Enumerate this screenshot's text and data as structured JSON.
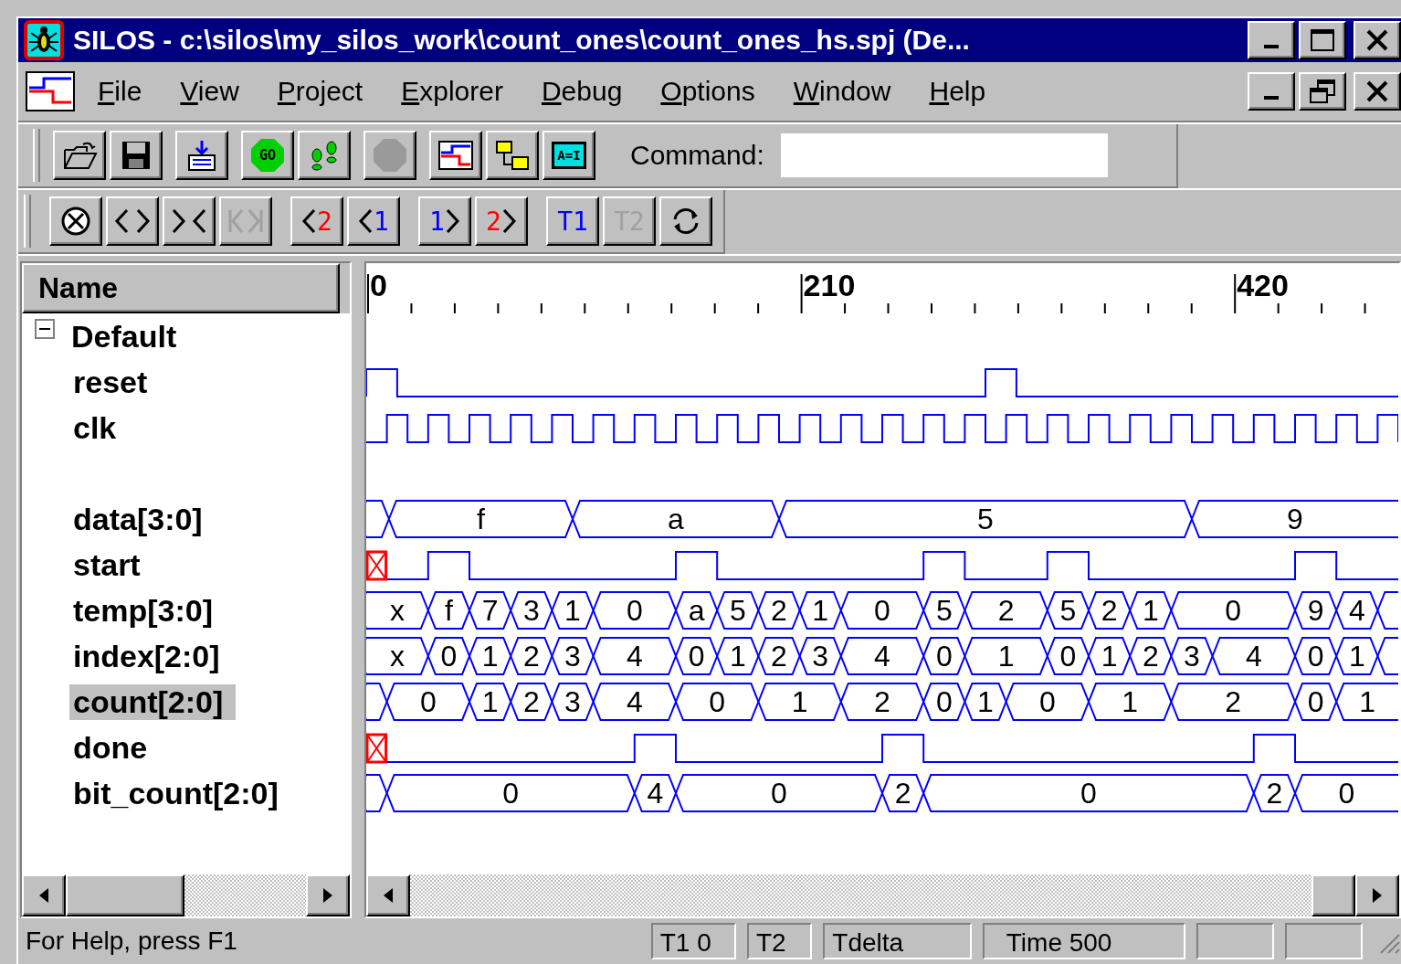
{
  "window": {
    "title": "SILOS - c:\\silos\\my_silos_work\\count_ones\\count_ones_hs.spj (De..."
  },
  "menu": [
    "File",
    "View",
    "Project",
    "Explorer",
    "Debug",
    "Options",
    "Window",
    "Help"
  ],
  "toolbar": [
    [
      {
        "kind": "open",
        "disabled": false
      },
      {
        "kind": "save",
        "disabled": false
      }
    ],
    [
      {
        "kind": "load",
        "disabled": false
      }
    ],
    [
      {
        "kind": "go",
        "label": "GO",
        "disabled": false
      },
      {
        "kind": "step",
        "disabled": false
      }
    ],
    [
      {
        "kind": "stop",
        "disabled": true
      }
    ],
    [
      {
        "kind": "wave",
        "disabled": false
      },
      {
        "kind": "explorer",
        "disabled": false
      },
      {
        "kind": "watch",
        "label": "A=I",
        "disabled": false
      }
    ]
  ],
  "command": {
    "label": "Command:"
  },
  "navbar": [
    [
      {
        "kind": "clear",
        "disabled": false
      },
      {
        "kind": "expand",
        "disabled": false
      },
      {
        "kind": "shrink",
        "disabled": false
      },
      {
        "kind": "fit",
        "disabled": true
      }
    ],
    [
      {
        "kind": "prev",
        "label": "2",
        "color": "#ff0000",
        "disabled": false
      },
      {
        "kind": "prev",
        "label": "1",
        "color": "#0000ff",
        "disabled": false
      }
    ],
    [
      {
        "kind": "next",
        "label": "1",
        "color": "#0000ff",
        "disabled": false
      },
      {
        "kind": "next",
        "label": "2",
        "color": "#ff0000",
        "disabled": false
      }
    ],
    [
      {
        "kind": "cursor",
        "label": "T1",
        "color": "#0000ff",
        "disabled": false
      },
      {
        "kind": "cursor",
        "label": "T2",
        "disabled": true
      },
      {
        "kind": "refresh",
        "disabled": false
      }
    ]
  ],
  "names": {
    "header": "Name",
    "groups": [
      {
        "label": "Default",
        "expanded": true,
        "children": [
          {
            "name": "reset",
            "kind": "bit",
            "selected": false
          },
          {
            "name": "clk",
            "kind": "clock",
            "selected": false
          },
          {
            "kind": "spacer"
          },
          {
            "name": "data[3:0]",
            "kind": "bus",
            "selected": false,
            "values": [
              "f",
              "a",
              "5",
              "9"
            ]
          },
          {
            "name": "start",
            "kind": "bit",
            "selected": false
          },
          {
            "name": "temp[3:0]",
            "kind": "bus",
            "selected": false,
            "values": [
              "x",
              "f",
              "7",
              "3",
              "1",
              "0",
              "a",
              "5",
              "2",
              "1",
              "0",
              "5",
              "2",
              "5",
              "2",
              "1",
              "0",
              "9",
              "4"
            ]
          },
          {
            "name": "index[2:0]",
            "kind": "bus",
            "selected": false,
            "values": [
              "x",
              "0",
              "1",
              "2",
              "3",
              "4",
              "0",
              "1",
              "2",
              "3",
              "4",
              "0",
              "1",
              "0",
              "1",
              "2",
              "3",
              "4",
              "0",
              "1"
            ]
          },
          {
            "name": "count[2:0]",
            "kind": "bus",
            "selected": true,
            "values": [
              "0",
              "1",
              "2",
              "3",
              "4",
              "0",
              "1",
              "2",
              "0",
              "1",
              "0",
              "1",
              "2",
              "0",
              "1"
            ]
          },
          {
            "name": "done",
            "kind": "bit",
            "selected": false
          },
          {
            "name": "bit_count[2:0]",
            "kind": "bus",
            "selected": false,
            "values": [
              "0",
              "4",
              "0",
              "2",
              "0",
              "2",
              "0"
            ]
          }
        ]
      }
    ]
  },
  "timeline": {
    "labels": [
      "0",
      "210",
      "420"
    ]
  },
  "status_bar": {
    "message": "For Help, press F1",
    "panes": [
      "T1 0",
      "T2",
      "Tdelta",
      "Time 500"
    ]
  }
}
